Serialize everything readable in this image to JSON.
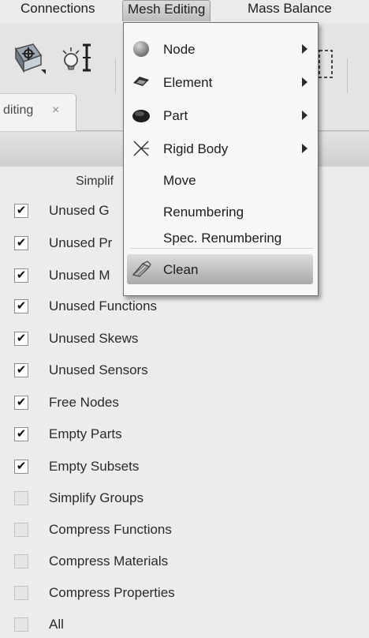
{
  "menubar": {
    "items": [
      {
        "label": "Connections"
      },
      {
        "label": "Mesh Editing"
      },
      {
        "label": "Mass Balance"
      }
    ]
  },
  "tab": {
    "label": "diting",
    "close": "×"
  },
  "panel": {
    "section_title": "Simplif"
  },
  "options": [
    {
      "label": "Unused G",
      "checked": true
    },
    {
      "label": "Unused Pr",
      "checked": true
    },
    {
      "label": "Unused M",
      "checked": true
    },
    {
      "label": "Unused Functions",
      "checked": true
    },
    {
      "label": "Unused Skews",
      "checked": true
    },
    {
      "label": "Unused Sensors",
      "checked": true
    },
    {
      "label": "Free Nodes",
      "checked": true
    },
    {
      "label": "Empty Parts",
      "checked": true
    },
    {
      "label": "Empty Subsets",
      "checked": true
    },
    {
      "label": "Simplify Groups",
      "checked": false
    },
    {
      "label": "Compress Functions",
      "checked": false
    },
    {
      "label": "Compress Materials",
      "checked": false
    },
    {
      "label": "Compress Properties",
      "checked": false
    },
    {
      "label": "All",
      "checked": false
    }
  ],
  "check_glyph": "✔",
  "dropdown": {
    "items": [
      {
        "label": "Node",
        "icon": "sphere-icon",
        "submenu": true
      },
      {
        "label": "Element",
        "icon": "element-icon",
        "submenu": true
      },
      {
        "label": "Part",
        "icon": "part-icon",
        "submenu": true
      },
      {
        "label": "Rigid Body",
        "icon": "rigid-body-icon",
        "submenu": true
      },
      {
        "label": "Move",
        "icon": "",
        "submenu": false
      },
      {
        "label": "Renumbering",
        "icon": "",
        "submenu": false
      },
      {
        "label": "Spec. Renumbering",
        "icon": "",
        "submenu": false
      },
      {
        "label": "Clean",
        "icon": "clean-icon",
        "submenu": false,
        "highlighted": true
      }
    ]
  }
}
